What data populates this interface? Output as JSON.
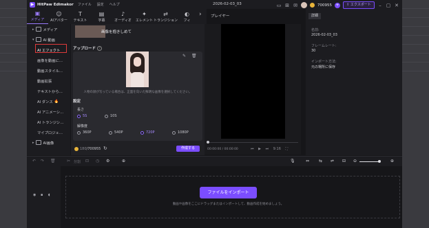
{
  "window": {
    "app_name": "HitPaw Edimakor",
    "menu": [
      "ファイル",
      "設定",
      "ヘルプ"
    ],
    "project_title": "2026-02-03_03",
    "credits": "700955",
    "export_label": "エクスポート"
  },
  "toolbar": {
    "tools": [
      {
        "label": "メディア",
        "icon": "media-icon",
        "glyph": "▣"
      },
      {
        "label": "AIアバター",
        "icon": "ai-avatar-icon",
        "glyph": "☺"
      },
      {
        "label": "テキスト",
        "icon": "text-icon",
        "glyph": "T"
      },
      {
        "label": "字幕",
        "icon": "subtitle-icon",
        "glyph": "▤"
      },
      {
        "label": "オーディオ",
        "icon": "audio-icon",
        "glyph": "♪"
      },
      {
        "label": "エレメント",
        "icon": "element-icon",
        "glyph": "✦"
      },
      {
        "label": "トランジション",
        "icon": "transition-icon",
        "glyph": "⇄"
      },
      {
        "label": "フィ",
        "icon": "filter-icon",
        "glyph": "◐"
      }
    ],
    "active_index": 0
  },
  "sidebar": {
    "media": "メディア",
    "ai_video": "AI 動画",
    "items": [
      "AI エフェクト",
      "画像を動画に…",
      "動画スタイル…",
      "動画拡張",
      "テキストから…",
      "AI ダンス",
      "AI アニメーシ…",
      "AI トランジシ…",
      "マイプロジェ…"
    ],
    "ai_image": "AI画像",
    "selected_index": 0
  },
  "panel": {
    "thumb_label": "画像を抱きしめて",
    "upload_title": "アップロード",
    "upload_hint": "人物の顔が写っている場合は、正面を向いた鮮明な画像を選択してください。",
    "settings_title": "設定",
    "length_label": "長さ",
    "length_options": [
      "5S",
      "10S"
    ],
    "length_selected": "5S",
    "resolution_label": "解像度",
    "resolution_options": [
      "360P",
      "540P",
      "720P",
      "1080P"
    ],
    "resolution_selected": "720P",
    "cost": "180",
    "balance": "/700955",
    "create_label": "作成する"
  },
  "player": {
    "label": "プレイヤー",
    "time": "00:00:00 / 00:00:00",
    "controls": [
      "⏮",
      "▶",
      "⏭",
      "9:16",
      "⛶"
    ]
  },
  "details": {
    "tab": "詳細",
    "fields": [
      {
        "key": "名前:",
        "value": "2026-02-03_03"
      },
      {
        "key": "フレームレート:",
        "value": "30"
      },
      {
        "key": "インポート方法:",
        "value": "元の場所に保存"
      }
    ]
  },
  "timeline": {
    "split_label": "分割",
    "import_label": "ファイルをインポート",
    "import_hint": "動画や画像をここにドラッグまたはインポートして、動画作成を始めましょう。"
  }
}
